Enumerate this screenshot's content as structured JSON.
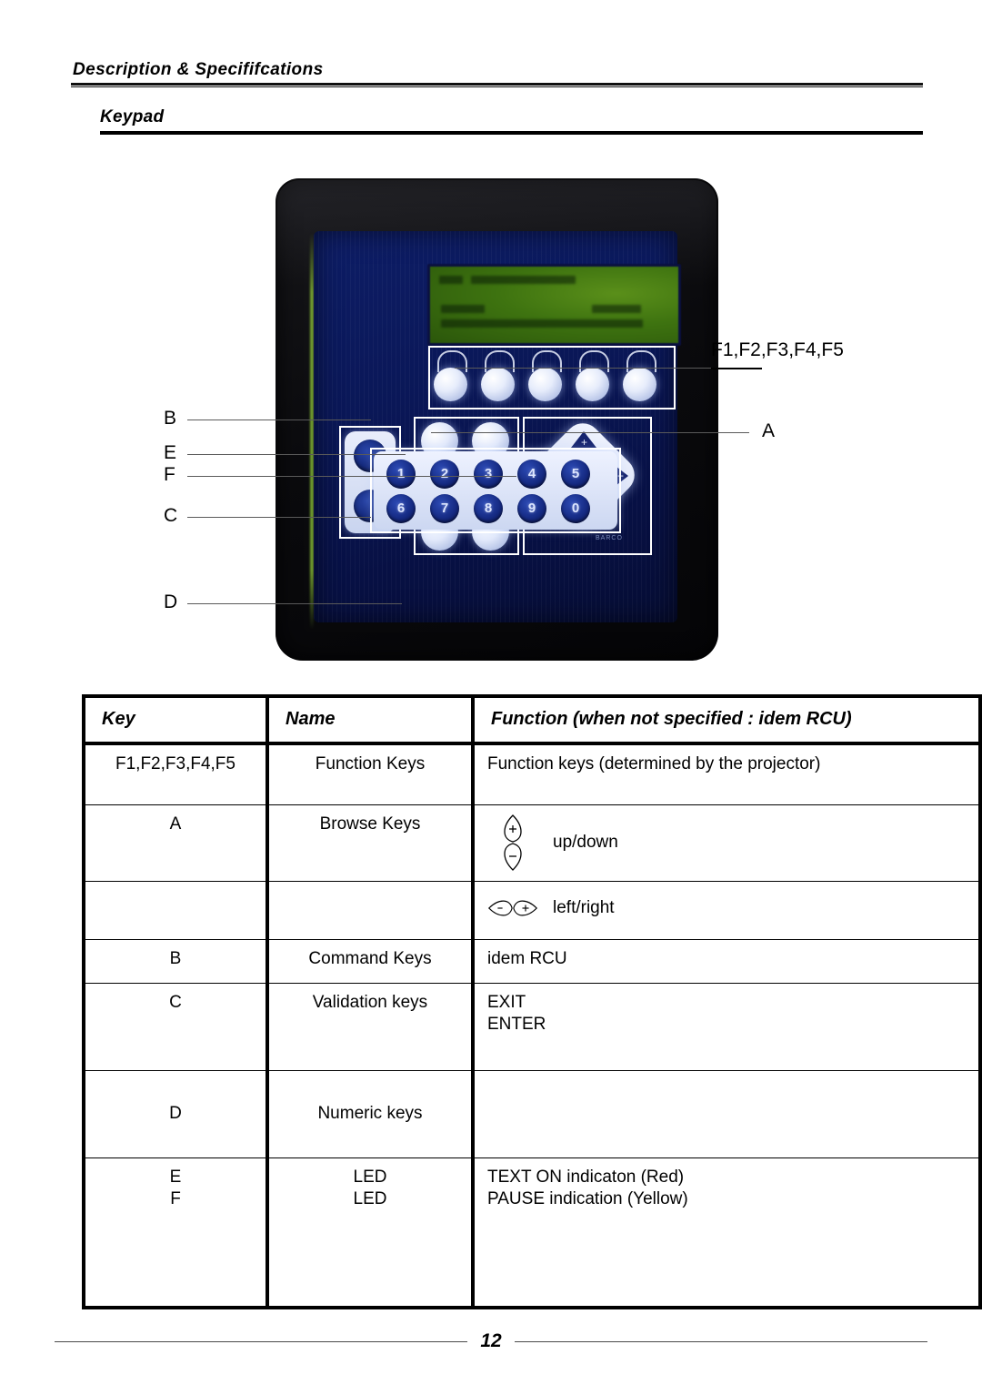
{
  "header": {
    "running_title": "Description & Specififcations",
    "section_title": "Keypad"
  },
  "figure": {
    "callouts": {
      "fkeys": "F1,F2,F3,F4,F5",
      "a": "A",
      "b": "B",
      "e": "E",
      "f": "F",
      "c": "C",
      "d": "D"
    },
    "numeric_keys": [
      "1",
      "2",
      "3",
      "4",
      "5",
      "6",
      "7",
      "8",
      "9",
      "0"
    ],
    "browse_pad": {
      "up": "+",
      "down": "-",
      "left": "-",
      "right": "+"
    },
    "brand": "BARCO",
    "colors": {
      "bezel": "#0b0b0e",
      "faceplate": "#0a1757",
      "lcd": "#3e7310",
      "key_white": "#e6ecfb",
      "key_blue": "#16247f"
    }
  },
  "table": {
    "columns": {
      "key": "Key",
      "name": "Name",
      "function": "Function (when not specified : idem RCU)"
    },
    "rows": [
      {
        "key": "F1,F2,F3,F4,F5",
        "name": "Function Keys",
        "function": "Function keys (determined by the projector)",
        "icon": "none"
      },
      {
        "key": "A",
        "name": "Browse Keys",
        "function": "up/down",
        "icon": "up-down"
      },
      {
        "key": "",
        "name": "",
        "function": "left/right",
        "icon": "left-right"
      },
      {
        "key": "B",
        "name": "Command Keys",
        "function": "idem RCU",
        "icon": "none"
      },
      {
        "key": "C",
        "name": "Validation keys",
        "function_line1": "EXIT",
        "function_line2": "ENTER",
        "icon": "none"
      },
      {
        "key": "D",
        "name": "Numeric keys",
        "function": "",
        "icon": "none"
      },
      {
        "key_line1": "E",
        "key_line2": "F",
        "name_line1": "LED",
        "name_line2": "LED",
        "function_line1": "TEXT ON indicaton (Red)",
        "function_line2": "PAUSE indication (Yellow)",
        "icon": "none"
      }
    ]
  },
  "footer": {
    "page_number": "12"
  }
}
